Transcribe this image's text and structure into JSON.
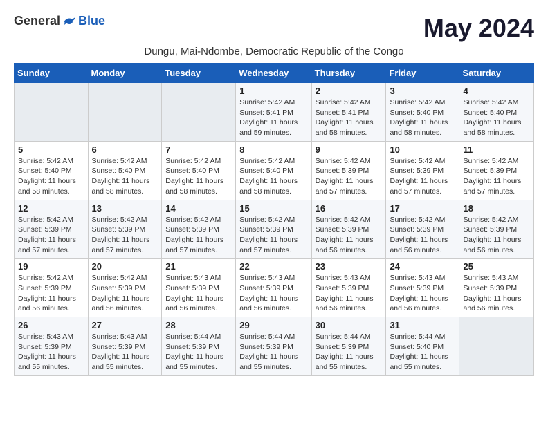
{
  "logo": {
    "general": "General",
    "blue": "Blue"
  },
  "title": "May 2024",
  "location": "Dungu, Mai-Ndombe, Democratic Republic of the Congo",
  "days_of_week": [
    "Sunday",
    "Monday",
    "Tuesday",
    "Wednesday",
    "Thursday",
    "Friday",
    "Saturday"
  ],
  "weeks": [
    [
      {
        "day": "",
        "info": ""
      },
      {
        "day": "",
        "info": ""
      },
      {
        "day": "",
        "info": ""
      },
      {
        "day": "1",
        "info": "Sunrise: 5:42 AM\nSunset: 5:41 PM\nDaylight: 11 hours and 59 minutes."
      },
      {
        "day": "2",
        "info": "Sunrise: 5:42 AM\nSunset: 5:41 PM\nDaylight: 11 hours and 58 minutes."
      },
      {
        "day": "3",
        "info": "Sunrise: 5:42 AM\nSunset: 5:40 PM\nDaylight: 11 hours and 58 minutes."
      },
      {
        "day": "4",
        "info": "Sunrise: 5:42 AM\nSunset: 5:40 PM\nDaylight: 11 hours and 58 minutes."
      }
    ],
    [
      {
        "day": "5",
        "info": "Sunrise: 5:42 AM\nSunset: 5:40 PM\nDaylight: 11 hours and 58 minutes."
      },
      {
        "day": "6",
        "info": "Sunrise: 5:42 AM\nSunset: 5:40 PM\nDaylight: 11 hours and 58 minutes."
      },
      {
        "day": "7",
        "info": "Sunrise: 5:42 AM\nSunset: 5:40 PM\nDaylight: 11 hours and 58 minutes."
      },
      {
        "day": "8",
        "info": "Sunrise: 5:42 AM\nSunset: 5:40 PM\nDaylight: 11 hours and 58 minutes."
      },
      {
        "day": "9",
        "info": "Sunrise: 5:42 AM\nSunset: 5:39 PM\nDaylight: 11 hours and 57 minutes."
      },
      {
        "day": "10",
        "info": "Sunrise: 5:42 AM\nSunset: 5:39 PM\nDaylight: 11 hours and 57 minutes."
      },
      {
        "day": "11",
        "info": "Sunrise: 5:42 AM\nSunset: 5:39 PM\nDaylight: 11 hours and 57 minutes."
      }
    ],
    [
      {
        "day": "12",
        "info": "Sunrise: 5:42 AM\nSunset: 5:39 PM\nDaylight: 11 hours and 57 minutes."
      },
      {
        "day": "13",
        "info": "Sunrise: 5:42 AM\nSunset: 5:39 PM\nDaylight: 11 hours and 57 minutes."
      },
      {
        "day": "14",
        "info": "Sunrise: 5:42 AM\nSunset: 5:39 PM\nDaylight: 11 hours and 57 minutes."
      },
      {
        "day": "15",
        "info": "Sunrise: 5:42 AM\nSunset: 5:39 PM\nDaylight: 11 hours and 57 minutes."
      },
      {
        "day": "16",
        "info": "Sunrise: 5:42 AM\nSunset: 5:39 PM\nDaylight: 11 hours and 56 minutes."
      },
      {
        "day": "17",
        "info": "Sunrise: 5:42 AM\nSunset: 5:39 PM\nDaylight: 11 hours and 56 minutes."
      },
      {
        "day": "18",
        "info": "Sunrise: 5:42 AM\nSunset: 5:39 PM\nDaylight: 11 hours and 56 minutes."
      }
    ],
    [
      {
        "day": "19",
        "info": "Sunrise: 5:42 AM\nSunset: 5:39 PM\nDaylight: 11 hours and 56 minutes."
      },
      {
        "day": "20",
        "info": "Sunrise: 5:42 AM\nSunset: 5:39 PM\nDaylight: 11 hours and 56 minutes."
      },
      {
        "day": "21",
        "info": "Sunrise: 5:43 AM\nSunset: 5:39 PM\nDaylight: 11 hours and 56 minutes."
      },
      {
        "day": "22",
        "info": "Sunrise: 5:43 AM\nSunset: 5:39 PM\nDaylight: 11 hours and 56 minutes."
      },
      {
        "day": "23",
        "info": "Sunrise: 5:43 AM\nSunset: 5:39 PM\nDaylight: 11 hours and 56 minutes."
      },
      {
        "day": "24",
        "info": "Sunrise: 5:43 AM\nSunset: 5:39 PM\nDaylight: 11 hours and 56 minutes."
      },
      {
        "day": "25",
        "info": "Sunrise: 5:43 AM\nSunset: 5:39 PM\nDaylight: 11 hours and 56 minutes."
      }
    ],
    [
      {
        "day": "26",
        "info": "Sunrise: 5:43 AM\nSunset: 5:39 PM\nDaylight: 11 hours and 55 minutes."
      },
      {
        "day": "27",
        "info": "Sunrise: 5:43 AM\nSunset: 5:39 PM\nDaylight: 11 hours and 55 minutes."
      },
      {
        "day": "28",
        "info": "Sunrise: 5:44 AM\nSunset: 5:39 PM\nDaylight: 11 hours and 55 minutes."
      },
      {
        "day": "29",
        "info": "Sunrise: 5:44 AM\nSunset: 5:39 PM\nDaylight: 11 hours and 55 minutes."
      },
      {
        "day": "30",
        "info": "Sunrise: 5:44 AM\nSunset: 5:39 PM\nDaylight: 11 hours and 55 minutes."
      },
      {
        "day": "31",
        "info": "Sunrise: 5:44 AM\nSunset: 5:40 PM\nDaylight: 11 hours and 55 minutes."
      },
      {
        "day": "",
        "info": ""
      }
    ]
  ]
}
